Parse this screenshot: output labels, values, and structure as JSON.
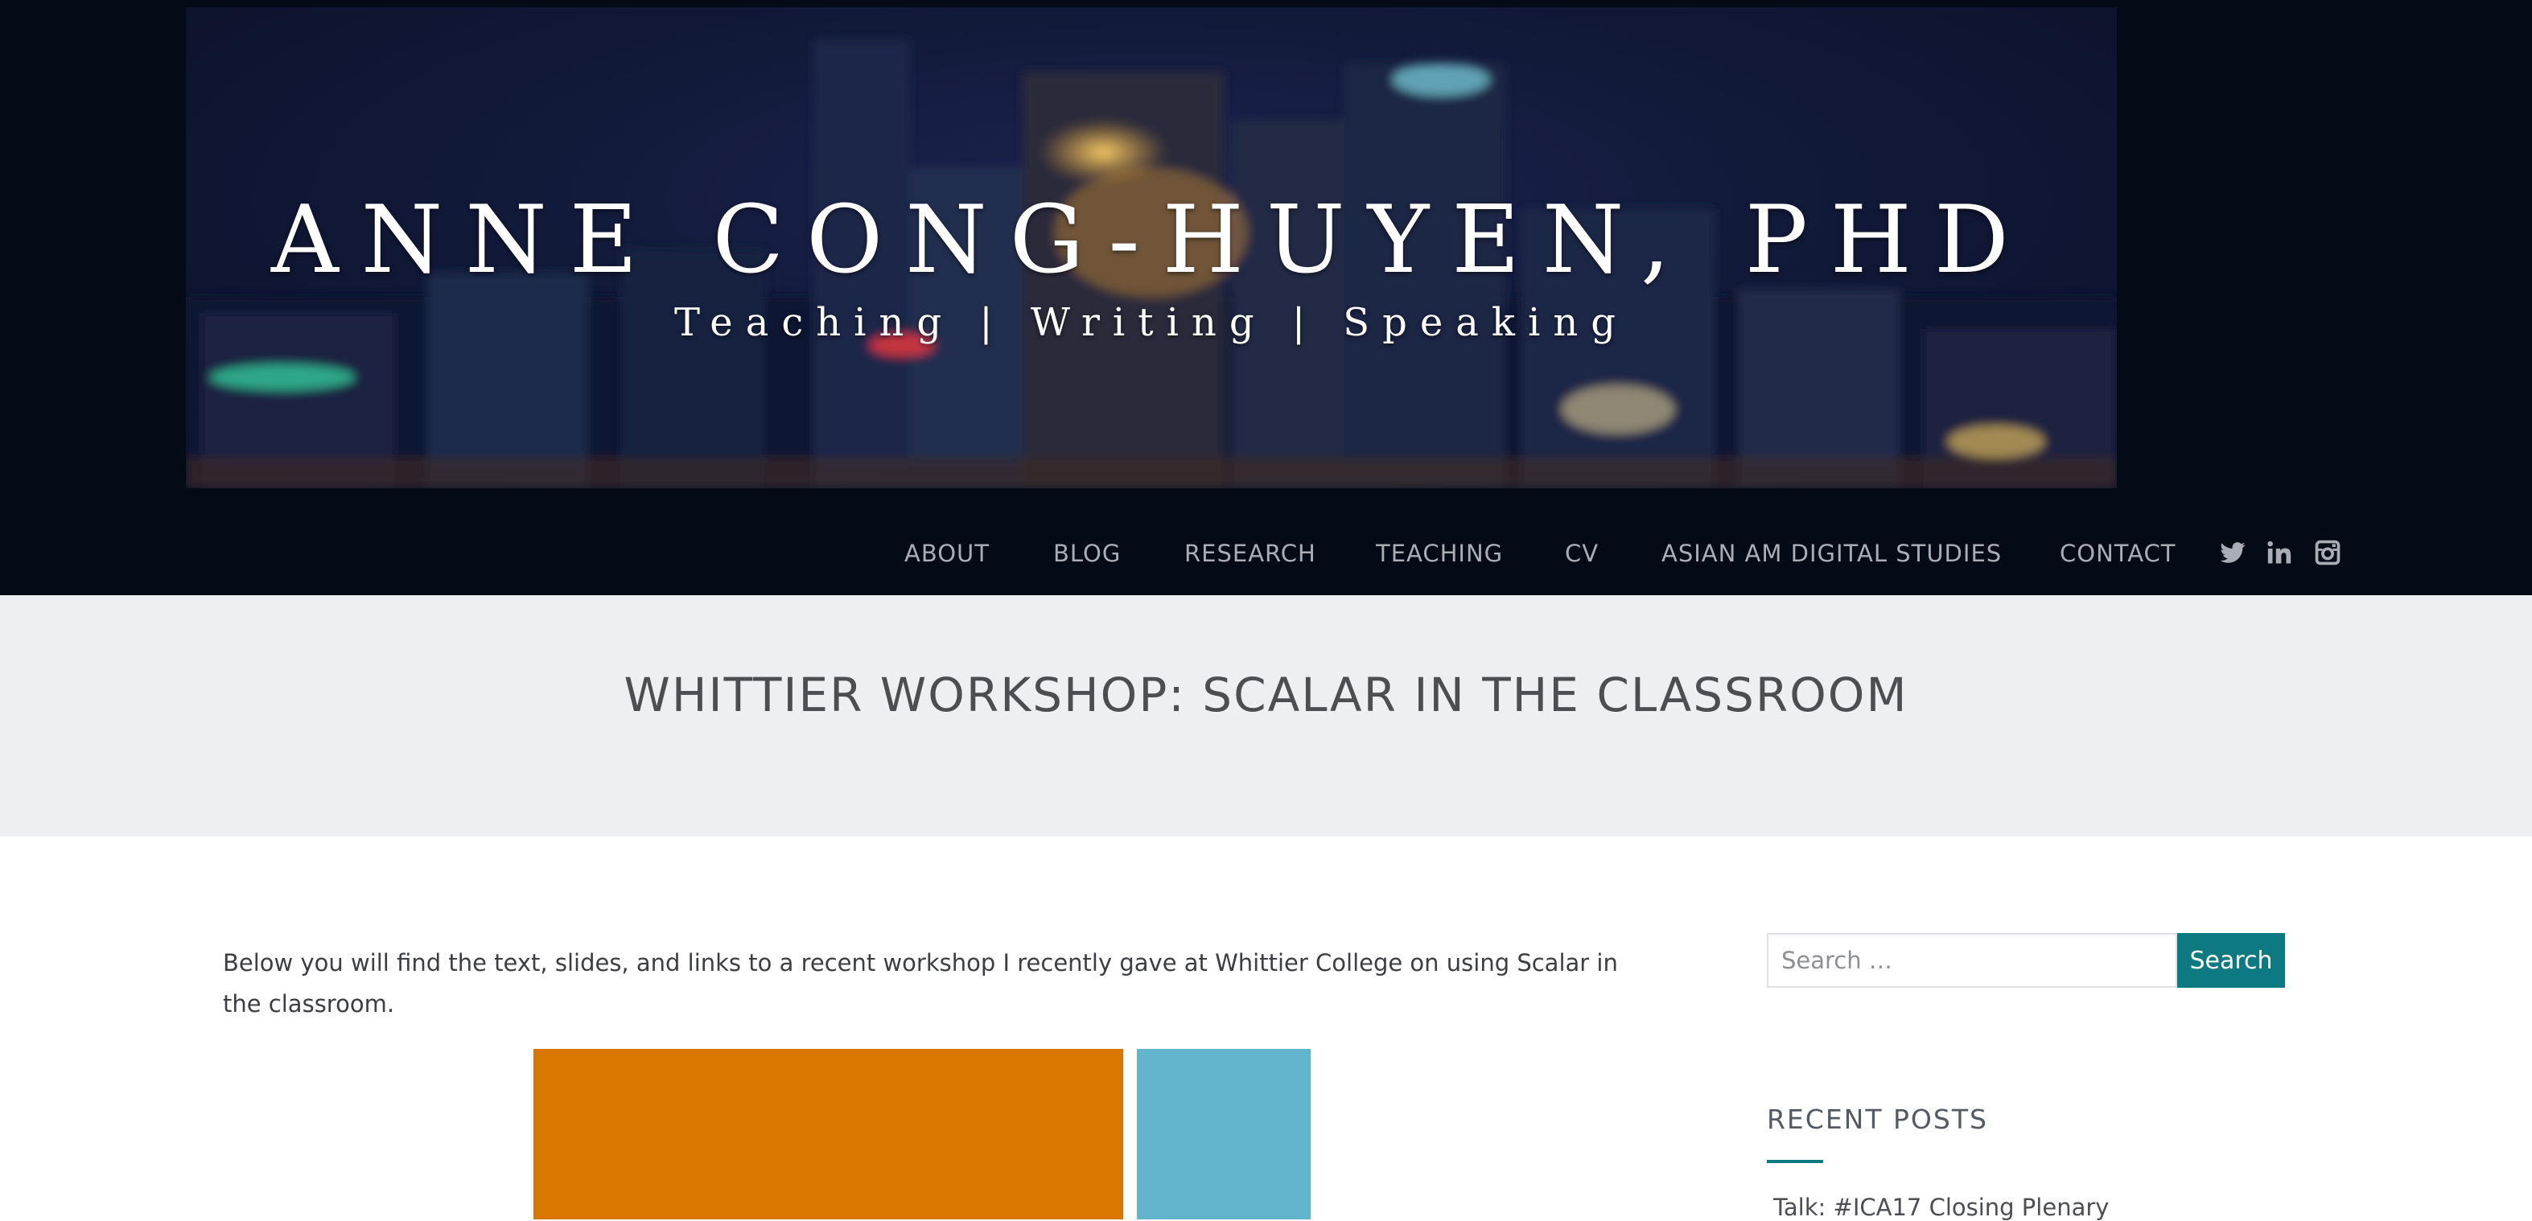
{
  "header": {
    "site_title": "ANNE CONG-HUYEN, PHD",
    "tagline": "Teaching | Writing | Speaking"
  },
  "nav": {
    "items": [
      {
        "label": "ABOUT"
      },
      {
        "label": "BLOG"
      },
      {
        "label": "RESEARCH"
      },
      {
        "label": "TEACHING"
      },
      {
        "label": "CV"
      },
      {
        "label": "ASIAN AM DIGITAL STUDIES"
      },
      {
        "label": "CONTACT"
      }
    ],
    "social_icons": [
      "twitter-icon",
      "linkedin-icon",
      "instagram-icon"
    ]
  },
  "page": {
    "title": "WHITTIER WORKSHOP: SCALAR IN THE CLASSROOM"
  },
  "content": {
    "intro": "Below you will find the text, slides, and links to a recent workshop I recently gave at Whittier College on using Scalar in the classroom."
  },
  "sidebar": {
    "search": {
      "placeholder": "Search …",
      "button_label": "Search"
    },
    "recent_posts": {
      "title": "RECENT POSTS",
      "items": [
        "Talk: #ICA17 Closing Plenary"
      ]
    }
  },
  "colors": {
    "masthead_bg": "#020b16",
    "accent": "#0c7a80",
    "title_band_bg": "#eeeff3",
    "thumb_orange": "#da7602",
    "thumb_blue": "#63b5cd"
  }
}
